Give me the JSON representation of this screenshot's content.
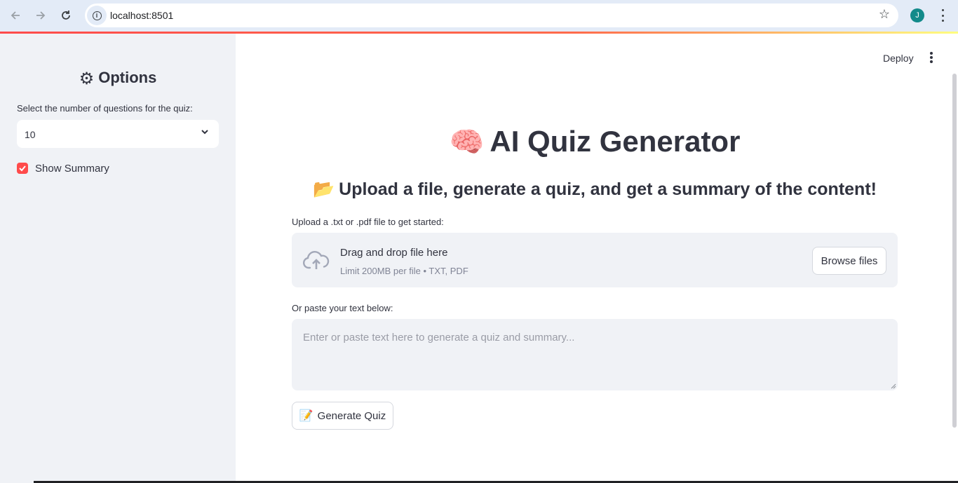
{
  "browser": {
    "url": "localhost:8501",
    "profile_initial": "J"
  },
  "header": {
    "deploy_label": "Deploy"
  },
  "sidebar": {
    "title": "Options",
    "title_icon": "gear-icon",
    "select_label": "Select the number of questions for the quiz:",
    "select_value": "10",
    "checkbox_label": "Show Summary",
    "checkbox_checked": true
  },
  "main": {
    "title": "AI Quiz Generator",
    "title_emoji": "🧠",
    "subtitle": "Upload a file, generate a quiz, and get a summary of the content!",
    "subtitle_emoji": "📂",
    "upload_label": "Upload a .txt or .pdf file to get started:",
    "dropzone_title": "Drag and drop file here",
    "dropzone_limit": "Limit 200MB per file • TXT, PDF",
    "browse_label": "Browse files",
    "paste_label": "Or paste your text below:",
    "textarea_placeholder": "Enter or paste text here to generate a quiz and summary...",
    "generate_label": "Generate Quiz",
    "generate_emoji": "📝"
  },
  "colors": {
    "accent": "#ff4b4b",
    "sidebar_bg": "#f0f2f6",
    "text": "#31333f"
  }
}
